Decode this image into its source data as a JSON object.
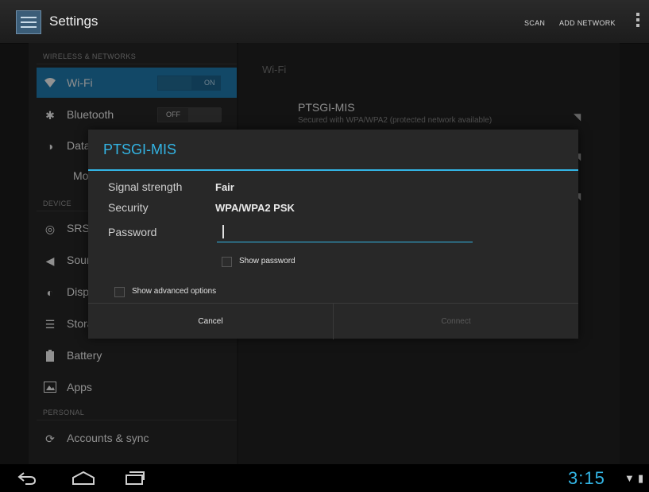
{
  "actionbar": {
    "title": "Settings",
    "scan_label": "SCAN",
    "add_network_label": "ADD NETWORK"
  },
  "sidebar": {
    "section_wireless": "WIRELESS & NETWORKS",
    "section_device": "DEVICE",
    "section_personal": "PERSONAL",
    "items": [
      {
        "label": "Wi-Fi",
        "icon": "wifi-icon",
        "toggle": "ON"
      },
      {
        "label": "Bluetooth",
        "icon": "bluetooth-icon",
        "toggle": "OFF"
      },
      {
        "label": "Data usage",
        "icon": "data-usage-icon"
      },
      {
        "label": "More…"
      },
      {
        "label": "SRS",
        "icon": "srs-icon"
      },
      {
        "label": "Sound",
        "icon": "sound-icon"
      },
      {
        "label": "Display",
        "icon": "display-icon"
      },
      {
        "label": "Storage",
        "icon": "storage-icon"
      },
      {
        "label": "Battery",
        "icon": "battery-icon"
      },
      {
        "label": "Apps",
        "icon": "apps-icon"
      },
      {
        "label": "Accounts & sync",
        "icon": "sync-icon"
      }
    ]
  },
  "wifi_panel": {
    "header": "Wi-Fi",
    "networks": [
      {
        "name": "PTSGI-MIS",
        "status": "Secured with WPA/WPA2 (protected network available)"
      }
    ]
  },
  "dialog": {
    "title": "PTSGI-MIS",
    "signal_label": "Signal strength",
    "signal_value": "Fair",
    "security_label": "Security",
    "security_value": "WPA/WPA2 PSK",
    "password_label": "Password",
    "password_value": "",
    "show_password_label": "Show password",
    "advanced_label": "Show advanced options",
    "cancel_label": "Cancel",
    "connect_label": "Connect"
  },
  "statusbar": {
    "clock": "3:15"
  },
  "colors": {
    "accent": "#33b5e5",
    "selected": "#1c6f9e",
    "disabled_text": "#5a5a5a"
  }
}
